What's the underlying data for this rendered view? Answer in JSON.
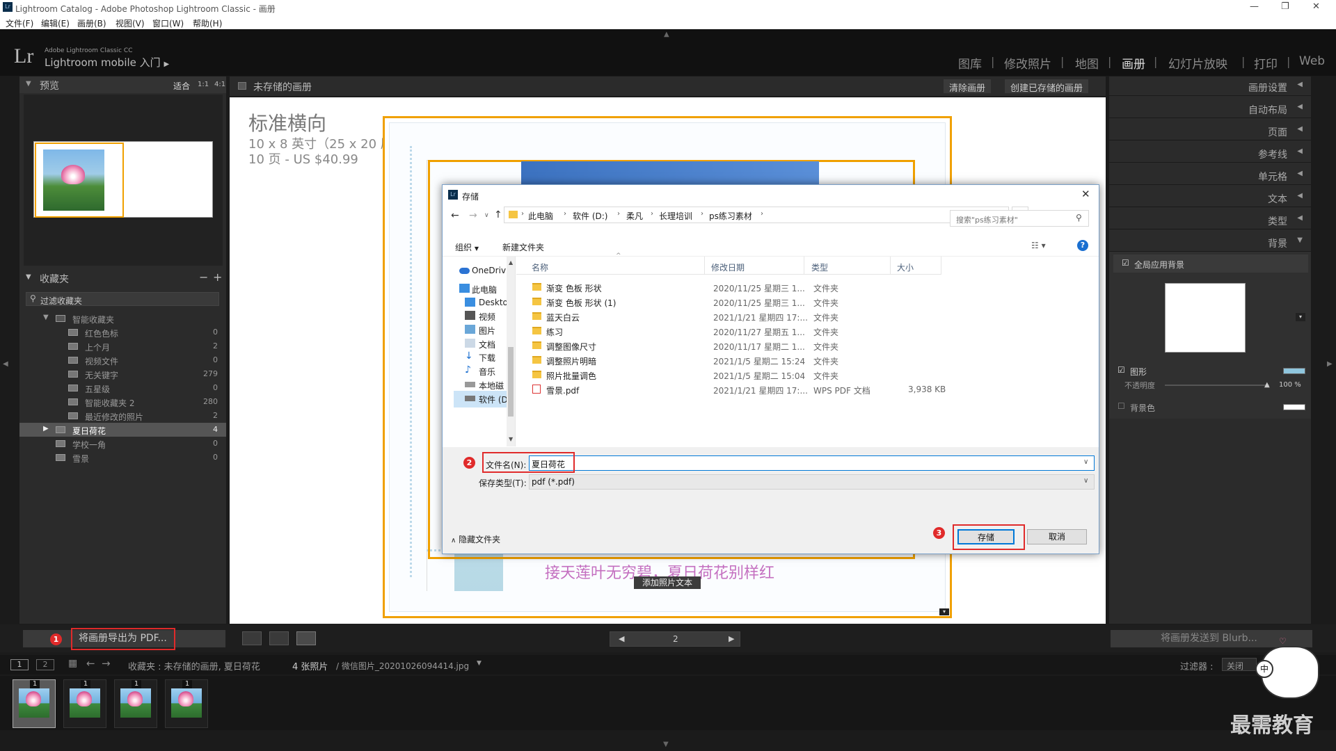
{
  "window": {
    "title": "Lightroom Catalog - Adobe Photoshop Lightroom Classic - 画册"
  },
  "menu": [
    "文件(F)",
    "编辑(E)",
    "画册(B)",
    "视图(V)",
    "窗口(W)",
    "帮助(H)"
  ],
  "identity": {
    "line1": "Adobe Lightroom Classic CC",
    "line2": "Lightroom mobile 入门"
  },
  "modules": [
    "图库",
    "修改照片",
    "地图",
    "画册",
    "幻灯片放映",
    "打印",
    "Web"
  ],
  "preview": {
    "title": "预览",
    "opts": [
      "适合",
      "1:1",
      "4:1"
    ]
  },
  "collections": {
    "title": "收藏夹",
    "filter": "过滤收藏夹",
    "smart_folder": "智能收藏夹",
    "items": [
      {
        "name": "红色色标",
        "count": "0"
      },
      {
        "name": "上个月",
        "count": "2"
      },
      {
        "name": "视频文件",
        "count": "0"
      },
      {
        "name": "无关键字",
        "count": "279"
      },
      {
        "name": "五星级",
        "count": "0"
      },
      {
        "name": "智能收藏夹 2",
        "count": "280"
      },
      {
        "name": "最近修改的照片",
        "count": "2"
      }
    ],
    "others": [
      {
        "name": "夏日荷花",
        "count": "4"
      },
      {
        "name": "学校一角",
        "count": "0"
      },
      {
        "name": "雪景",
        "count": "0"
      }
    ]
  },
  "toolbar": {
    "book_title": "未存储的画册",
    "clear": "清除画册",
    "create": "创建已存储的画册"
  },
  "book_info": {
    "title": "标准横向",
    "size": "10 x 8 英寸（25 x 20 厘米）",
    "pages": "10 页 - US $40.99"
  },
  "page_caption": "接天莲叶无穷碧，夏日荷花别样红",
  "add_text": "添加照片文本",
  "right_panel": {
    "sections": [
      "画册设置",
      "自动布局",
      "页面",
      "参考线",
      "单元格",
      "文本",
      "类型",
      "背景"
    ],
    "global_bg": "全局应用背景",
    "graphic": "图形",
    "opacity_label": "不透明度",
    "opacity_value": "100 %",
    "bg_color": "背景色"
  },
  "dialog": {
    "title": "存储",
    "path": [
      "此电脑",
      "软件 (D:)",
      "柔凡",
      "长理培训",
      "ps练习素材"
    ],
    "search_placeholder": "搜索\"ps练习素材\"",
    "organize": "组织",
    "new_folder": "新建文件夹",
    "columns": [
      "名称",
      "修改日期",
      "类型",
      "大小"
    ],
    "files": [
      {
        "name": "渐变 色板 形状",
        "date": "2020/11/25 星期三 1...",
        "type": "文件夹",
        "size": ""
      },
      {
        "name": "渐变 色板 形状 (1)",
        "date": "2020/11/25 星期三 1...",
        "type": "文件夹",
        "size": ""
      },
      {
        "name": "蓝天白云",
        "date": "2021/1/21 星期四 17:...",
        "type": "文件夹",
        "size": ""
      },
      {
        "name": "练习",
        "date": "2020/11/27 星期五 1...",
        "type": "文件夹",
        "size": ""
      },
      {
        "name": "调整图像尺寸",
        "date": "2020/11/17 星期二 1...",
        "type": "文件夹",
        "size": ""
      },
      {
        "name": "调整照片明暗",
        "date": "2021/1/5 星期二 15:24",
        "type": "文件夹",
        "size": ""
      },
      {
        "name": "照片批量调色",
        "date": "2021/1/5 星期二 15:04",
        "type": "文件夹",
        "size": ""
      },
      {
        "name": "雪景.pdf",
        "date": "2021/1/21 星期四 17:...",
        "type": "WPS PDF 文档",
        "size": "3,938 KB"
      }
    ],
    "nav": [
      "OneDriv",
      "此电脑",
      "Deskto",
      "视频",
      "图片",
      "文档",
      "下载",
      "音乐",
      "本地磁",
      "软件 (D"
    ],
    "filename_label": "文件名(N):",
    "filename_value": "夏日荷花",
    "filetype_label": "保存类型(T):",
    "filetype_value": "pdf (*.pdf)",
    "hide_folders": "隐藏文件夹",
    "save": "存储",
    "cancel": "取消"
  },
  "bottom": {
    "export_pdf": "将画册导出为 PDF...",
    "page_num": "2",
    "send_blurb": "将画册发送到 Blurb..."
  },
  "filmstrip": {
    "source": "收藏夹 : 未存储的画册, 夏日荷花",
    "count": "4 张照片",
    "file": "/ 微信图片_20201026094414.jpg",
    "filter_label": "过滤器 :",
    "filter_value": "关闭",
    "thumbs": [
      "1",
      "1",
      "1",
      "1"
    ]
  },
  "badges": [
    "1",
    "2",
    "3"
  ],
  "watermark": "最需教育"
}
